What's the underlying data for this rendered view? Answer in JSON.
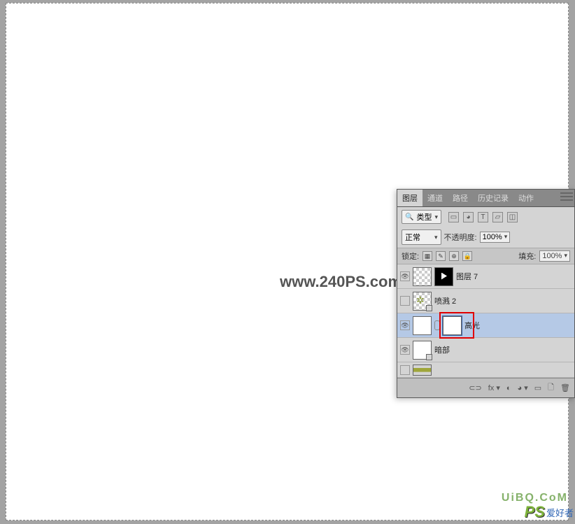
{
  "watermark": "www.240PS.com",
  "panel": {
    "tabs": [
      "图层",
      "通道",
      "路径",
      "历史记录",
      "动作"
    ],
    "activeTab": 0,
    "filter": {
      "kind": "类型",
      "icons": [
        "▭",
        "◕",
        "T",
        "▱",
        "◫"
      ]
    },
    "blend": {
      "mode": "正常",
      "opacityLabel": "不透明度:",
      "opacity": "100%"
    },
    "lock": {
      "label": "锁定:",
      "fillLabel": "填充:",
      "fill": "100%",
      "icons": [
        "▦",
        "✎",
        "⊕",
        "🔒"
      ]
    },
    "layers": [
      {
        "vis": true,
        "name": "图层 7",
        "thumbs": [
          "trans",
          "mask"
        ]
      },
      {
        "vis": false,
        "name": "喷溅 2",
        "thumbs": [
          "trans"
        ],
        "smart": true,
        "burst": true
      },
      {
        "vis": true,
        "name": "高光",
        "thumbs": [
          "whit",
          "whit"
        ],
        "link": true,
        "selected": true,
        "redbox": true
      },
      {
        "vis": true,
        "name": "暗部",
        "thumbs": [
          "whit"
        ],
        "smart": true
      },
      {
        "vis": false,
        "name": "",
        "thumbs": [
          "greenstrip"
        ]
      }
    ],
    "footer": [
      "⊂⊃",
      "fx ▾",
      "◐",
      "◕ ▾",
      "▭",
      "🗋",
      "🗑"
    ]
  },
  "brand": {
    "url": "UiBQ.CoM",
    "ps": "PS",
    "zh": "爱好者"
  }
}
